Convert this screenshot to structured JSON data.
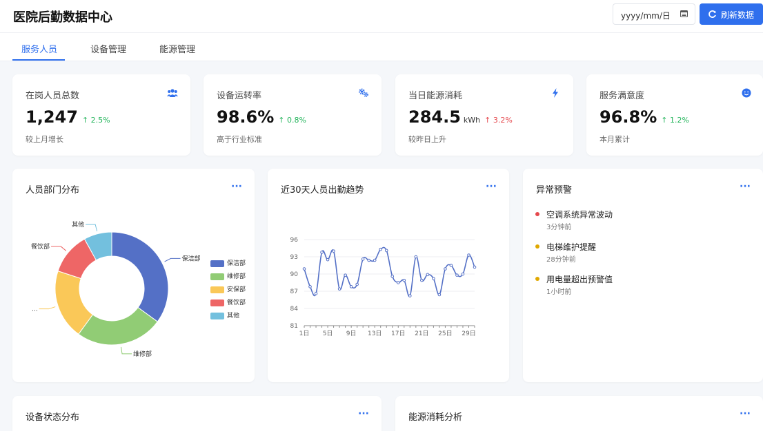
{
  "app": {
    "title": "医院后勤数据中心"
  },
  "toolbar": {
    "date_placeholder": "yyyy/mm/日",
    "refresh_label": "刷新数据"
  },
  "tabs": [
    {
      "label": "服务人员",
      "active": true
    },
    {
      "label": "设备管理",
      "active": false
    },
    {
      "label": "能源管理",
      "active": false
    }
  ],
  "kpis": [
    {
      "label": "在岗人员总数",
      "icon": "users-icon",
      "value": "1,247",
      "unit": "",
      "change": "↑ 2.5%",
      "trend": "up-good",
      "note": "较上月增长"
    },
    {
      "label": "设备运转率",
      "icon": "gears-icon",
      "value": "98.6%",
      "unit": "",
      "change": "↑ 0.8%",
      "trend": "up-good",
      "note": "高于行业标准"
    },
    {
      "label": "当日能源消耗",
      "icon": "bolt-icon",
      "value": "284.5",
      "unit": "kWh",
      "change": "↑ 3.2%",
      "trend": "up-bad",
      "note": "较昨日上升"
    },
    {
      "label": "服务满意度",
      "icon": "smile-icon",
      "value": "96.8%",
      "unit": "",
      "change": "↑ 1.2%",
      "trend": "up-good",
      "note": "本月累计"
    }
  ],
  "panels": {
    "departments": {
      "title": "人员部门分布",
      "more": "···"
    },
    "attendance": {
      "title": "近30天人员出勤趋势",
      "more": "···"
    },
    "alerts": {
      "title": "异常预警",
      "more": "···"
    },
    "equipment": {
      "title": "设备状态分布",
      "more": "···"
    },
    "energy": {
      "title": "能源消耗分析",
      "more": "···"
    }
  },
  "alerts": [
    {
      "title": "空调系统异常波动",
      "time": "3分钟前",
      "color": "#e5484d"
    },
    {
      "title": "电梯维护提醒",
      "time": "28分钟前",
      "color": "#e0a800"
    },
    {
      "title": "用电量超出预警值",
      "time": "1小时前",
      "color": "#e0a800"
    }
  ],
  "colors": {
    "accent": "#2f6fed",
    "good": "#22b45a",
    "bad": "#e5484d"
  },
  "chart_data": [
    {
      "type": "pie",
      "donut": true,
      "categories": [
        "保洁部",
        "维修部",
        "安保部",
        "餐饮部",
        "其他"
      ],
      "values": [
        35,
        25,
        20,
        12,
        8
      ],
      "colors": [
        "#5470c6",
        "#91cc75",
        "#fac858",
        "#ee6666",
        "#73c0de"
      ],
      "outer_labels": [
        "保洁部",
        "维修部",
        "...",
        "餐饮部",
        "其他"
      ],
      "legend": "right"
    },
    {
      "type": "line",
      "x": [
        "1日",
        "2日",
        "3日",
        "4日",
        "5日",
        "6日",
        "7日",
        "8日",
        "9日",
        "10日",
        "11日",
        "12日",
        "13日",
        "14日",
        "15日",
        "16日",
        "17日",
        "18日",
        "19日",
        "20日",
        "21日",
        "22日",
        "23日",
        "24日",
        "25日",
        "26日",
        "27日",
        "28日",
        "29日",
        "30日"
      ],
      "xticks": [
        "1日",
        "5日",
        "9日",
        "13日",
        "17日",
        "21日",
        "25日",
        "29日"
      ],
      "series": [
        {
          "values": [
            90.9,
            87.8,
            86.6,
            93.8,
            92.5,
            94.0,
            87.4,
            89.8,
            87.8,
            88.2,
            92.6,
            92.4,
            92.4,
            94.3,
            94.1,
            89.6,
            88.5,
            88.9,
            86.2,
            93.0,
            88.9,
            89.9,
            89.2,
            86.4,
            90.9,
            91.5,
            89.8,
            90.0,
            93.3,
            91.2
          ],
          "color": "#5470c6"
        }
      ],
      "yticks": [
        81,
        84,
        87,
        90,
        93,
        96
      ],
      "ylim": [
        81,
        96
      ],
      "grid": true
    }
  ]
}
